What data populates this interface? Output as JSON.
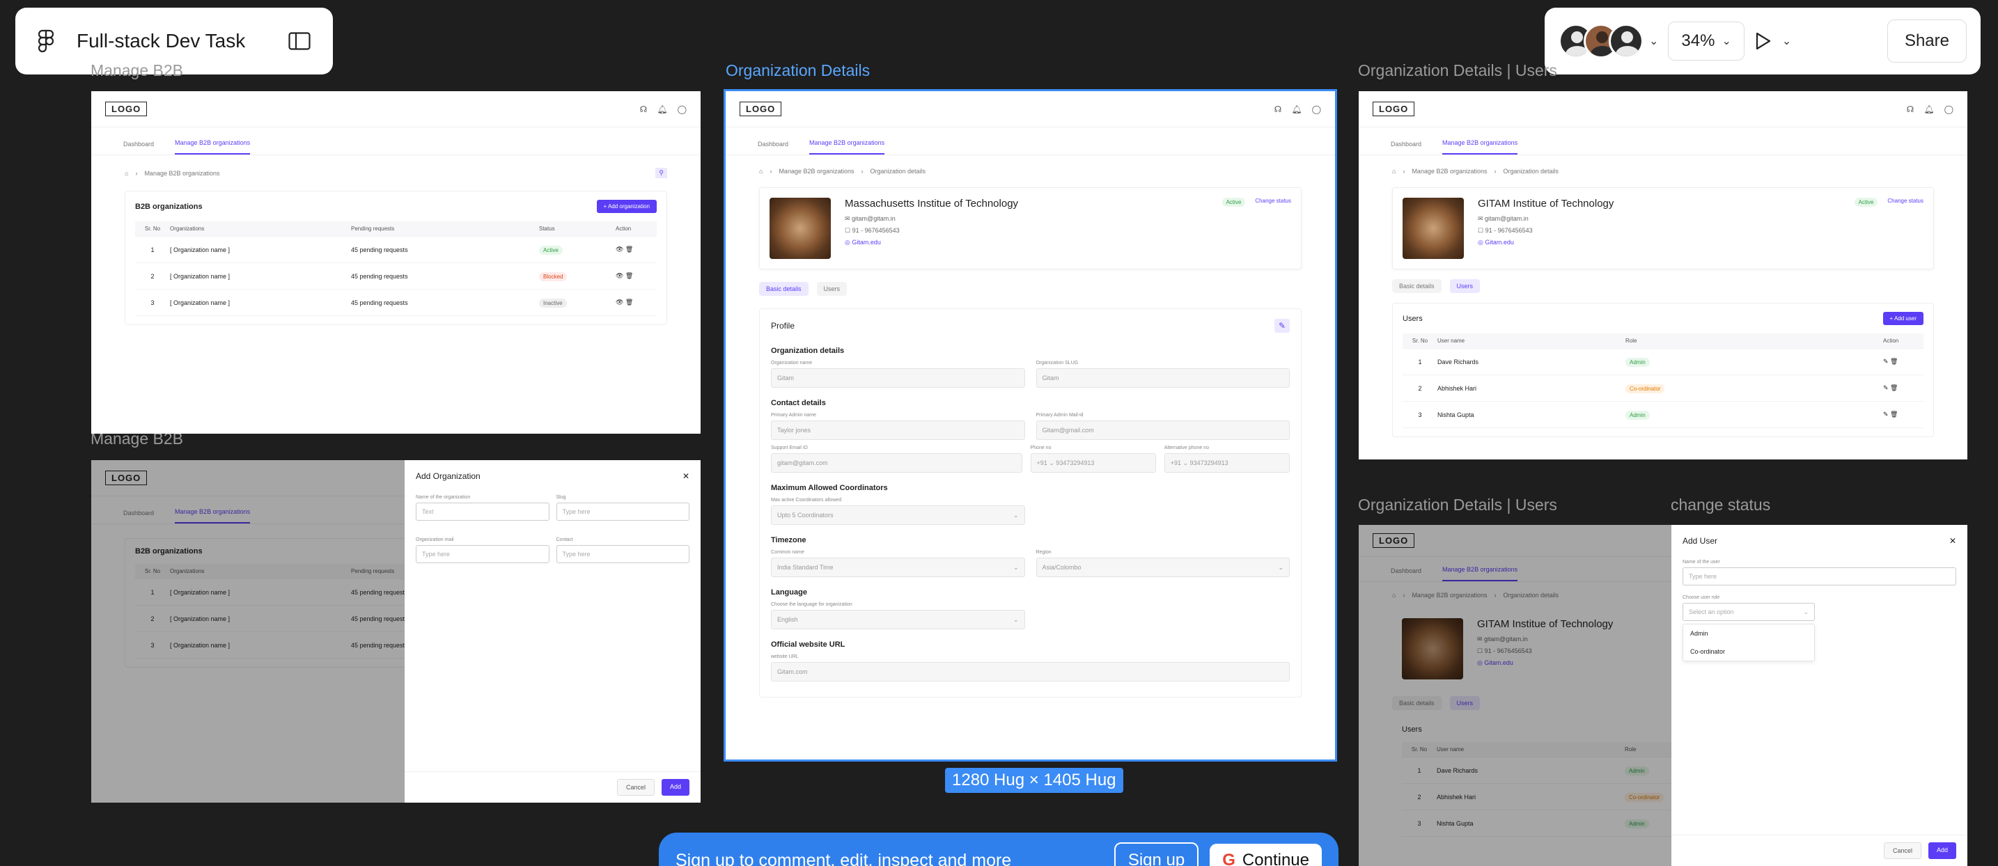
{
  "file_title": "Full-stack Dev Task",
  "zoom": "34%",
  "share_label": "Share",
  "frame_size_label": "1280 Hug × 1405 Hug",
  "signup_banner": {
    "text": "Sign up to comment, edit, inspect and more",
    "signup": "Sign up",
    "continue": "Continue"
  },
  "frames": {
    "f1": "Manage B2B",
    "f2": "Manage B2B",
    "f3": "Organization Details",
    "f4": "Organization Details | Users",
    "f5": "Organization Details | Users",
    "f6": "change status"
  },
  "app": {
    "logo": "LOGO",
    "tab_dashboard": "Dashboard",
    "tab_manage": "Manage B2B organizations",
    "crumb_manage": "Manage B2B organizations",
    "crumb_details": "Organization details"
  },
  "b2b": {
    "title": "B2B organizations",
    "add": "+ Add organization",
    "headers": [
      "Sr. No",
      "Organizations",
      "Pending requests",
      "Status",
      "Action"
    ],
    "rows": [
      {
        "no": "1",
        "name": "[ Organization name ]",
        "pending": "45 pending requests",
        "status": "Active"
      },
      {
        "no": "2",
        "name": "[ Organization name ]",
        "pending": "45 pending requests",
        "status": "Blocked"
      },
      {
        "no": "3",
        "name": "[ Organization name ]",
        "pending": "45 pending requests",
        "status": "Inactive"
      }
    ]
  },
  "add_org": {
    "title": "Add Organization",
    "name_label": "Name of the organization",
    "name_ph": "Text",
    "slug_label": "Slug",
    "slug_ph": "Type here",
    "mail_label": "Organization mail",
    "mail_ph": "Type here",
    "contact_label": "Contact",
    "contact_ph": "Type here",
    "cancel": "Cancel",
    "add": "Add"
  },
  "mit": {
    "name": "Massachusetts Institue of Technology",
    "email": "gitam@gitam.in",
    "phone": "91 - 9676456543",
    "web": "Gitam.edu",
    "status": "Active",
    "change_status": "Change status",
    "tab_basic": "Basic details",
    "tab_users": "Users",
    "profile": "Profile",
    "org_details": "Organization details",
    "org_name_label": "Organization name",
    "org_name": "Gitam",
    "slug_label": "Organization SLUG",
    "slug": "Gitam",
    "contact_details": "Contact details",
    "admin_label": "Primary Admin name",
    "admin": "Taylor jones",
    "admin_mail_label": "Primary Admin Mail-id",
    "admin_mail": "Gitam@gmail.com",
    "support_label": "Support Email ID",
    "support": "gitam@gitam.com",
    "phone_label": "Phone no",
    "phone_val": "+91 ⌄  93473294913",
    "alt_label": "Alternative phone no",
    "alt_val": "+91 ⌄  93473294913",
    "max_coord": "Maximum Allowed Coordinators",
    "max_label": "Max active Coordinators allowed",
    "max_val": "Upto 5 Coordinators",
    "timezone": "Timezone",
    "tz_label": "Common name",
    "tz_val": "India Standard Time",
    "region_label": "Region",
    "region_val": "Asia/Colombo",
    "language": "Language",
    "lang_label": "Choose the language for organization",
    "lang_val": "English",
    "website": "Official website URL",
    "web_label": "website URL",
    "web_val": "Gitam.com"
  },
  "gitam": {
    "name": "GITAM Institue of Technology",
    "email": "gitam@gitam.in",
    "phone": "91 - 9676456543",
    "web": "Gitam.edu",
    "users_title": "Users",
    "add_user": "+ Add user",
    "headers": [
      "Sr. No",
      "User name",
      "Role",
      "Action"
    ],
    "rows": [
      {
        "no": "1",
        "name": "Dave Richards",
        "role": "Admin"
      },
      {
        "no": "2",
        "name": "Abhishek Hari",
        "role": "Co-ordinator"
      },
      {
        "no": "3",
        "name": "Nishta Gupta",
        "role": "Admin"
      }
    ]
  },
  "add_user": {
    "title": "Add User",
    "name_label": "Name of the user",
    "name_ph": "Type here",
    "role_label": "Choose user role",
    "role_ph": "Select an option",
    "options": [
      "Admin",
      "Co-ordinator"
    ],
    "cancel": "Cancel",
    "add": "Add"
  }
}
